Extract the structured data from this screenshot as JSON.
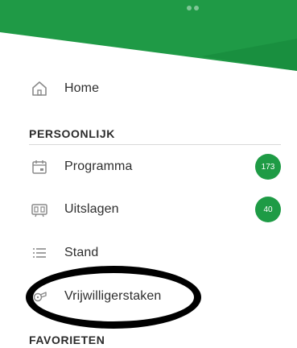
{
  "colors": {
    "brand_green": "#1e9b45",
    "dark_green": "#178a3c",
    "annotation": "#000000"
  },
  "menu": {
    "home": {
      "label": "Home",
      "icon": "home-icon"
    },
    "section_personal": "PERSOONLIJK",
    "items": [
      {
        "label": "Programma",
        "icon": "calendar-icon",
        "badge": "173"
      },
      {
        "label": "Uitslagen",
        "icon": "scoreboard-icon",
        "badge": "40"
      },
      {
        "label": "Stand",
        "icon": "list-icon"
      },
      {
        "label": "Vrijwilligerstaken",
        "icon": "whistle-icon"
      }
    ],
    "section_favorites": "FAVORIETEN"
  }
}
